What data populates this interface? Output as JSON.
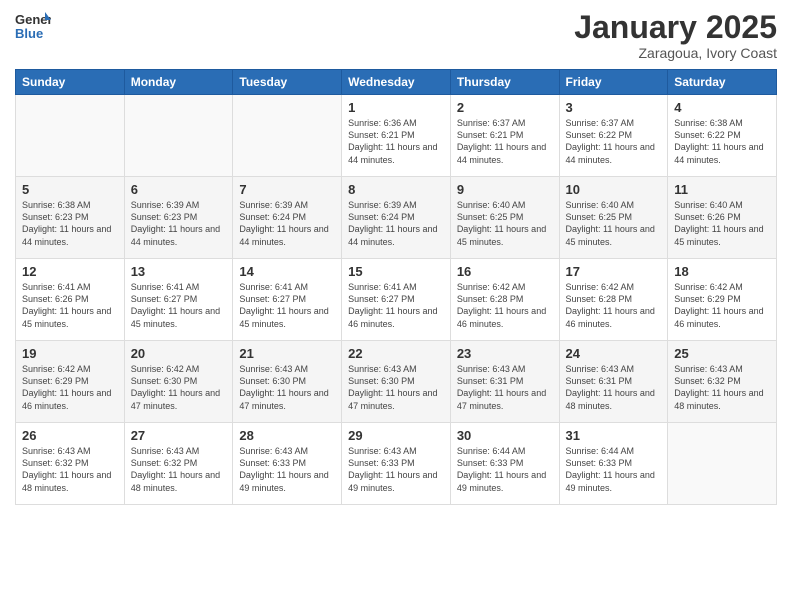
{
  "header": {
    "logo_general": "General",
    "logo_blue": "Blue",
    "month_title": "January 2025",
    "subtitle": "Zaragoua, Ivory Coast"
  },
  "weekdays": [
    "Sunday",
    "Monday",
    "Tuesday",
    "Wednesday",
    "Thursday",
    "Friday",
    "Saturday"
  ],
  "weeks": [
    [
      {
        "day": "",
        "info": ""
      },
      {
        "day": "",
        "info": ""
      },
      {
        "day": "",
        "info": ""
      },
      {
        "day": "1",
        "info": "Sunrise: 6:36 AM\nSunset: 6:21 PM\nDaylight: 11 hours and 44 minutes."
      },
      {
        "day": "2",
        "info": "Sunrise: 6:37 AM\nSunset: 6:21 PM\nDaylight: 11 hours and 44 minutes."
      },
      {
        "day": "3",
        "info": "Sunrise: 6:37 AM\nSunset: 6:22 PM\nDaylight: 11 hours and 44 minutes."
      },
      {
        "day": "4",
        "info": "Sunrise: 6:38 AM\nSunset: 6:22 PM\nDaylight: 11 hours and 44 minutes."
      }
    ],
    [
      {
        "day": "5",
        "info": "Sunrise: 6:38 AM\nSunset: 6:23 PM\nDaylight: 11 hours and 44 minutes."
      },
      {
        "day": "6",
        "info": "Sunrise: 6:39 AM\nSunset: 6:23 PM\nDaylight: 11 hours and 44 minutes."
      },
      {
        "day": "7",
        "info": "Sunrise: 6:39 AM\nSunset: 6:24 PM\nDaylight: 11 hours and 44 minutes."
      },
      {
        "day": "8",
        "info": "Sunrise: 6:39 AM\nSunset: 6:24 PM\nDaylight: 11 hours and 44 minutes."
      },
      {
        "day": "9",
        "info": "Sunrise: 6:40 AM\nSunset: 6:25 PM\nDaylight: 11 hours and 45 minutes."
      },
      {
        "day": "10",
        "info": "Sunrise: 6:40 AM\nSunset: 6:25 PM\nDaylight: 11 hours and 45 minutes."
      },
      {
        "day": "11",
        "info": "Sunrise: 6:40 AM\nSunset: 6:26 PM\nDaylight: 11 hours and 45 minutes."
      }
    ],
    [
      {
        "day": "12",
        "info": "Sunrise: 6:41 AM\nSunset: 6:26 PM\nDaylight: 11 hours and 45 minutes."
      },
      {
        "day": "13",
        "info": "Sunrise: 6:41 AM\nSunset: 6:27 PM\nDaylight: 11 hours and 45 minutes."
      },
      {
        "day": "14",
        "info": "Sunrise: 6:41 AM\nSunset: 6:27 PM\nDaylight: 11 hours and 45 minutes."
      },
      {
        "day": "15",
        "info": "Sunrise: 6:41 AM\nSunset: 6:27 PM\nDaylight: 11 hours and 46 minutes."
      },
      {
        "day": "16",
        "info": "Sunrise: 6:42 AM\nSunset: 6:28 PM\nDaylight: 11 hours and 46 minutes."
      },
      {
        "day": "17",
        "info": "Sunrise: 6:42 AM\nSunset: 6:28 PM\nDaylight: 11 hours and 46 minutes."
      },
      {
        "day": "18",
        "info": "Sunrise: 6:42 AM\nSunset: 6:29 PM\nDaylight: 11 hours and 46 minutes."
      }
    ],
    [
      {
        "day": "19",
        "info": "Sunrise: 6:42 AM\nSunset: 6:29 PM\nDaylight: 11 hours and 46 minutes."
      },
      {
        "day": "20",
        "info": "Sunrise: 6:42 AM\nSunset: 6:30 PM\nDaylight: 11 hours and 47 minutes."
      },
      {
        "day": "21",
        "info": "Sunrise: 6:43 AM\nSunset: 6:30 PM\nDaylight: 11 hours and 47 minutes."
      },
      {
        "day": "22",
        "info": "Sunrise: 6:43 AM\nSunset: 6:30 PM\nDaylight: 11 hours and 47 minutes."
      },
      {
        "day": "23",
        "info": "Sunrise: 6:43 AM\nSunset: 6:31 PM\nDaylight: 11 hours and 47 minutes."
      },
      {
        "day": "24",
        "info": "Sunrise: 6:43 AM\nSunset: 6:31 PM\nDaylight: 11 hours and 48 minutes."
      },
      {
        "day": "25",
        "info": "Sunrise: 6:43 AM\nSunset: 6:32 PM\nDaylight: 11 hours and 48 minutes."
      }
    ],
    [
      {
        "day": "26",
        "info": "Sunrise: 6:43 AM\nSunset: 6:32 PM\nDaylight: 11 hours and 48 minutes."
      },
      {
        "day": "27",
        "info": "Sunrise: 6:43 AM\nSunset: 6:32 PM\nDaylight: 11 hours and 48 minutes."
      },
      {
        "day": "28",
        "info": "Sunrise: 6:43 AM\nSunset: 6:33 PM\nDaylight: 11 hours and 49 minutes."
      },
      {
        "day": "29",
        "info": "Sunrise: 6:43 AM\nSunset: 6:33 PM\nDaylight: 11 hours and 49 minutes."
      },
      {
        "day": "30",
        "info": "Sunrise: 6:44 AM\nSunset: 6:33 PM\nDaylight: 11 hours and 49 minutes."
      },
      {
        "day": "31",
        "info": "Sunrise: 6:44 AM\nSunset: 6:33 PM\nDaylight: 11 hours and 49 minutes."
      },
      {
        "day": "",
        "info": ""
      }
    ]
  ]
}
